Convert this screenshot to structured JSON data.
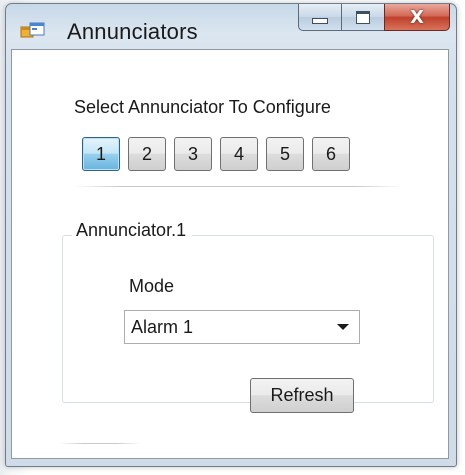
{
  "window": {
    "title": "Annunciators",
    "app_icon": "form-window-icon",
    "caption_buttons": {
      "minimize_icon": "minimize-icon",
      "maximize_icon": "maximize-icon",
      "close_icon": "close-icon",
      "close_glyph": "X"
    }
  },
  "selector": {
    "label": "Select Annunciator To Configure",
    "buttons": [
      "1",
      "2",
      "3",
      "4",
      "5",
      "6"
    ],
    "selected": "1"
  },
  "config": {
    "group_title": "Annunciator.1",
    "mode_label": "Mode",
    "mode_value": "Alarm 1",
    "refresh_label": "Refresh"
  },
  "colors": {
    "selected_button": "#98d1ef",
    "close_button": "#c0412b",
    "window_frame": "#c7d8e8"
  }
}
